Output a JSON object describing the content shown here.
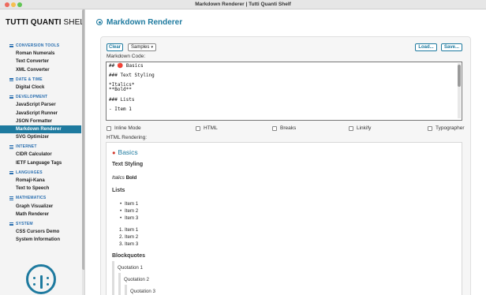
{
  "window": {
    "title": "Markdown Renderer | Tutti Quanti Shelf"
  },
  "brand": {
    "bold": "TUTTI QUANTI",
    "light": " SHELF"
  },
  "sidebar": {
    "categories": [
      {
        "name": "CONVERSION TOOLS",
        "items": [
          "Roman Numerals",
          "Text Converter",
          "XML Converter"
        ]
      },
      {
        "name": "DATE & TIME",
        "items": [
          "Digital Clock"
        ]
      },
      {
        "name": "DEVELOPMENT",
        "items": [
          "JavaScript Parser",
          "JavaScript Runner",
          "JSON Formatter",
          "Markdown Renderer",
          "SVG Optimizer"
        ]
      },
      {
        "name": "INTERNET",
        "items": [
          "CIDR Calculator",
          "IETF Language Tags"
        ]
      },
      {
        "name": "LANGUAGES",
        "items": [
          "Romaji-Kana",
          "Text to Speech"
        ]
      },
      {
        "name": "MATHEMATICS",
        "items": [
          "Graph Visualizer",
          "Math Renderer"
        ]
      },
      {
        "name": "SYSTEM",
        "items": [
          "CSS Cursors Demo",
          "System Information"
        ]
      }
    ],
    "active_item": "Markdown Renderer"
  },
  "page": {
    "title": "Markdown Renderer"
  },
  "toolbar": {
    "clear": "Clear",
    "samples": "Samples",
    "load": "Load...",
    "save": "Save..."
  },
  "labels": {
    "code": "Markdown Code:",
    "rendering": "HTML Rendering:"
  },
  "editor": {
    "text": "## 🔴 Basics\n\n### Text Styling\n\n*Italics*\n**Bold**\n\n### Lists\n\n- Item 1"
  },
  "options": [
    "Inline Mode",
    "HTML",
    "Breaks",
    "Linkify",
    "Typographer"
  ],
  "rendered": {
    "h1": "Basics",
    "h3_styling": "Text Styling",
    "italics": "Italics",
    "bold": "Bold",
    "h3_lists": "Lists",
    "bullets": [
      "Item 1",
      "Item 2",
      "Item 3"
    ],
    "numbered": [
      "Item 1",
      "Item 2",
      "Item 3"
    ],
    "number_marks": [
      "1.",
      "2.",
      "3."
    ],
    "h3_quotes": "Blockquotes",
    "quotes": [
      "Quotation 1",
      "Quotation 2",
      "Quotation 3"
    ]
  },
  "colors": {
    "accent": "#1e7a9f",
    "category": "#2a6fb0",
    "emoji_red": "#d23b2f"
  }
}
